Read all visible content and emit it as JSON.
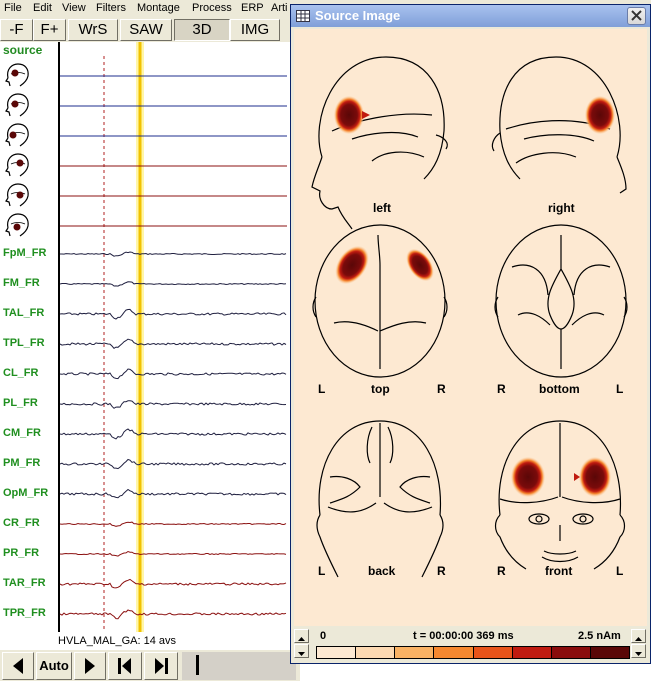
{
  "menu": [
    "File",
    "Edit",
    "View",
    "Filters",
    "Montage",
    "Process",
    "ERP",
    "Arti"
  ],
  "toolbar": {
    "minus_f": "-F",
    "plus_f": "F+",
    "wrs": "WrS",
    "saw": "SAW",
    "threed": "3D",
    "img": "IMG"
  },
  "source_header": "source",
  "channels": [
    "FpM_FR",
    "FM_FR",
    "TAL_FR",
    "TPL_FR",
    "CL_FR",
    "PL_FR",
    "CM_FR",
    "PM_FR",
    "OpM_FR",
    "CR_FR",
    "PR_FR",
    "TAR_FR",
    "TPR_FR"
  ],
  "status_text": "HVLA_MAL_GA: 14 avs",
  "playbar": {
    "auto_label": "Auto",
    "icons": [
      "prev-icon",
      "next-icon",
      "step-back-icon",
      "step-forward-icon"
    ]
  },
  "source_window": {
    "title": "Source Image",
    "views": {
      "left": {
        "label": "left"
      },
      "right": {
        "label": "right"
      },
      "top": {
        "label": "top",
        "side_left": "L",
        "side_right": "R"
      },
      "bottom": {
        "label": "bottom",
        "side_left": "R",
        "side_right": "L"
      },
      "back": {
        "label": "back",
        "side_left": "L",
        "side_right": "R"
      },
      "front": {
        "label": "front",
        "side_left": "R",
        "side_right": "L"
      }
    },
    "colorbar": {
      "min_label": "0",
      "time_label": "t = 00:00:00  369 ms",
      "max_label": "2.5 nAm",
      "colors": [
        "#fde9d2",
        "#fcd9b2",
        "#f9b264",
        "#f6882f",
        "#e8541a",
        "#c01b10",
        "#8a0c0c",
        "#5a0707"
      ]
    }
  },
  "colors": {
    "label_green": "#1f8f1f",
    "trace_blue": "#1e2d8c",
    "trace_red": "#8b1010",
    "trace_dark": "#202040",
    "cursor_yellow": "#f2c200",
    "source_dark": "#5a0707"
  }
}
